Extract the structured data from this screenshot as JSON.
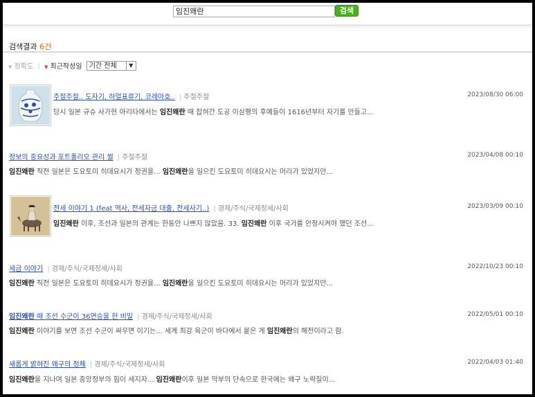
{
  "search": {
    "query": "임진왜란",
    "button_label": "검색"
  },
  "results_header": {
    "label": "검색결과",
    "count": "6건"
  },
  "sort": {
    "accuracy_label": "정확도",
    "date_label": "최근작성일",
    "period_selected": "기간 전체"
  },
  "results": [
    {
      "title": "주절주절.. 도자기, 하얼표류기, 코레아호..",
      "category": "주절주절",
      "date": "2023/08/30 06:00",
      "thumbnail": "blue-white-porcelain-vase",
      "snippet": [
        {
          "t": "당시 일본 규슈 사가현 아리타에서는 ",
          "b": false
        },
        {
          "t": "임진왜란",
          "b": true
        },
        {
          "t": " 때 잡혀간 도공 이삼평의 후예들이 1616년부터 자기를 만들고...",
          "b": false
        }
      ]
    },
    {
      "title": "정보의 중요성과 포트폴리오 관리 썰",
      "category": "주절주절",
      "date": "2023/04/08 00:10",
      "snippet": [
        {
          "t": "임진왜란",
          "b": true
        },
        {
          "t": " 직전 일본은 도요토미 히데요시가 정권을... ",
          "b": false
        },
        {
          "t": "임진왜란",
          "b": true
        },
        {
          "t": "을 일으킨 도요토미 히데요시는 머리가 있었지만...",
          "b": false
        }
      ]
    },
    {
      "title": "전세 이야기 1 (feat 역사, 전세자금 대출, 전세사기..)",
      "category": "경제/주식/국제정세/사회",
      "date": "2023/03/09 00:10",
      "thumbnail": "rider-on-donkey-painting",
      "snippet": [
        {
          "t": "임진왜란",
          "b": true
        },
        {
          "t": " 이후, 조선과 일본의 관계는 한동안 나쁘지 않았음. 33. ",
          "b": false
        },
        {
          "t": "임진왜란",
          "b": true
        },
        {
          "t": " 이후 국가를 안정시켜야 했던 조선...",
          "b": false
        }
      ]
    },
    {
      "title": "세금 이야기",
      "category": "경제/주식/국제정세/사회",
      "date": "2022/10/23 00:10",
      "snippet": [
        {
          "t": "임진왜란",
          "b": true
        },
        {
          "t": " 직전 일본은 도요토미 히데요시가 정권을... ",
          "b": false
        },
        {
          "t": "임진왜란",
          "b": true
        },
        {
          "t": "을 일으킨 도요토미 히데요시는 머리가 있었지만...",
          "b": false
        }
      ]
    },
    {
      "title_parts": [
        {
          "t": "임진왜란",
          "b": true
        },
        {
          "t": " 때 조선 수군이 36연승을 한 비밀",
          "b": false
        }
      ],
      "category": "경제/주식/국제정세/사회",
      "date": "2022/05/01 00:10",
      "snippet": [
        {
          "t": "임진왜란",
          "b": true
        },
        {
          "t": " 이야기를 보면 조선 수군이 싸우면 이기는... 세계 최강 육군이 바다에서 붙은 게 ",
          "b": false
        },
        {
          "t": "임진왜란",
          "b": true
        },
        {
          "t": "의 해전이라고 함.",
          "b": false
        }
      ]
    },
    {
      "title": "새롭게 밝혀진 왜구의 정체",
      "category": "경제/주식/국제정세/사회",
      "date": "2022/04/03 01:40",
      "snippet": [
        {
          "t": "임진왜란",
          "b": true
        },
        {
          "t": "을 지나며 일본 중앙정부의 힘이 세지자... ",
          "b": false
        },
        {
          "t": "임진왜란",
          "b": true
        },
        {
          "t": "이후 일본 막부의 단속으로 한국에는 왜구 노략질이...",
          "b": false
        }
      ]
    }
  ]
}
